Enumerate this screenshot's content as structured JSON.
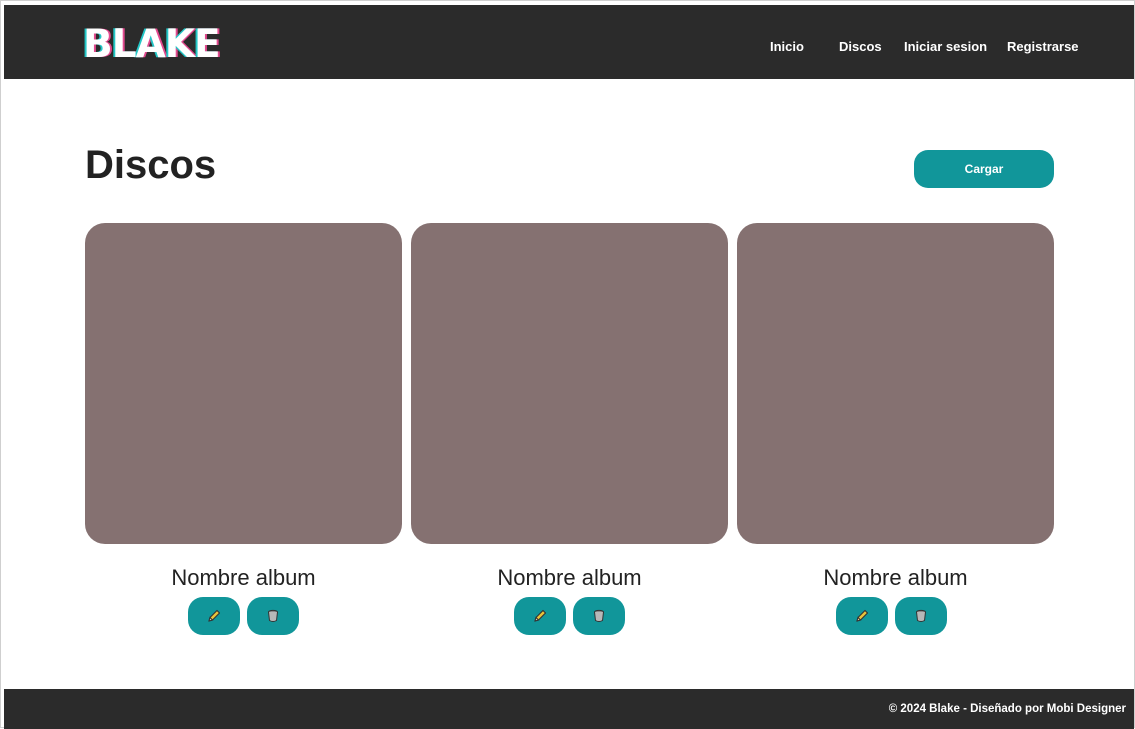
{
  "brand": {
    "logo_text": "BLAKE"
  },
  "nav": {
    "items": [
      {
        "label": "Inicio"
      },
      {
        "label": "Discos"
      },
      {
        "label": "Iniciar sesion"
      },
      {
        "label": "Registrarse"
      }
    ]
  },
  "main": {
    "title": "Discos",
    "upload_label": "Cargar",
    "albums": [
      {
        "name": "Nombre album",
        "edit_icon": "pencil-icon",
        "delete_icon": "trash-icon"
      },
      {
        "name": "Nombre album",
        "edit_icon": "pencil-icon",
        "delete_icon": "trash-icon"
      },
      {
        "name": "Nombre album",
        "edit_icon": "pencil-icon",
        "delete_icon": "trash-icon"
      }
    ]
  },
  "footer": {
    "text": "© 2024 Blake - Diseñado por Mobi Designer"
  },
  "colors": {
    "header_bg": "#2b2b2b",
    "accent": "#11969a",
    "cover_placeholder": "#857171",
    "text": "#222222"
  }
}
